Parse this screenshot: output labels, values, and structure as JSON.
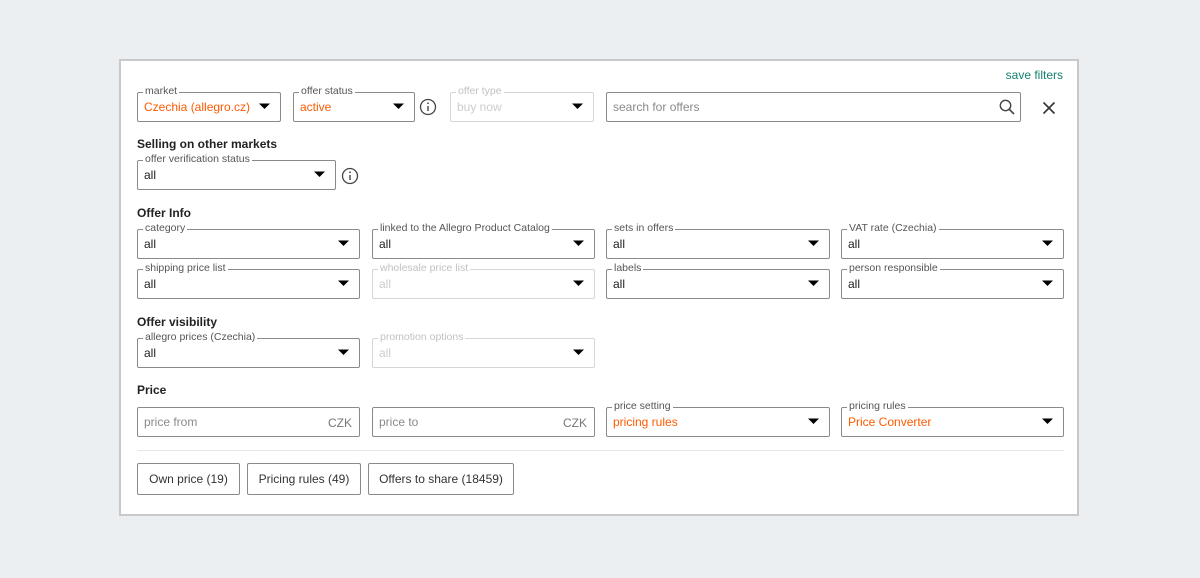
{
  "filters": {
    "save_filters": "save filters",
    "market": {
      "label": "market",
      "value": "Czechia (allegro.cz)"
    },
    "offer_status": {
      "label": "offer status",
      "value": "active"
    },
    "offer_type": {
      "label": "offer type",
      "value": "buy now"
    },
    "search": {
      "placeholder": "search for offers"
    }
  },
  "sections": {
    "selling_other_markets": {
      "title": "Selling on other markets",
      "verification_status": {
        "label": "offer verification status",
        "value": "all"
      }
    },
    "offer_info": {
      "title": "Offer Info",
      "category": {
        "label": "category",
        "value": "all"
      },
      "linked_catalog": {
        "label": "linked to the Allegro Product Catalog",
        "value": "all"
      },
      "sets_in_offers": {
        "label": "sets in offers",
        "value": "all"
      },
      "vat_rate": {
        "label": "VAT rate (Czechia)",
        "value": "all"
      },
      "shipping_price_list": {
        "label": "shipping price list",
        "value": "all"
      },
      "wholesale_price_list": {
        "label": "wholesale price list",
        "value": "all"
      },
      "labels": {
        "label": "labels",
        "value": "all"
      },
      "person_responsible": {
        "label": "person responsible",
        "value": "all"
      }
    },
    "offer_visibility": {
      "title": "Offer visibility",
      "allegro_prices": {
        "label": "allegro prices (Czechia)",
        "value": "all"
      },
      "promotion_options": {
        "label": "promotion options",
        "value": "all"
      }
    },
    "price": {
      "title": "Price",
      "price_from": {
        "placeholder": "price from",
        "unit": "CZK"
      },
      "price_to": {
        "placeholder": "price to",
        "unit": "CZK"
      },
      "price_setting": {
        "label": "price setting",
        "value": "pricing rules"
      },
      "pricing_rules": {
        "label": "pricing rules",
        "value": "Price Converter"
      }
    }
  },
  "buttons": {
    "own_price": "Own price (19)",
    "pricing_rules": "Pricing rules (49)",
    "offers_to_share": "Offers to share (18459)"
  },
  "colors": {
    "accent": "#ff5a00",
    "link": "#15806f",
    "border": "#8a8a8a"
  }
}
